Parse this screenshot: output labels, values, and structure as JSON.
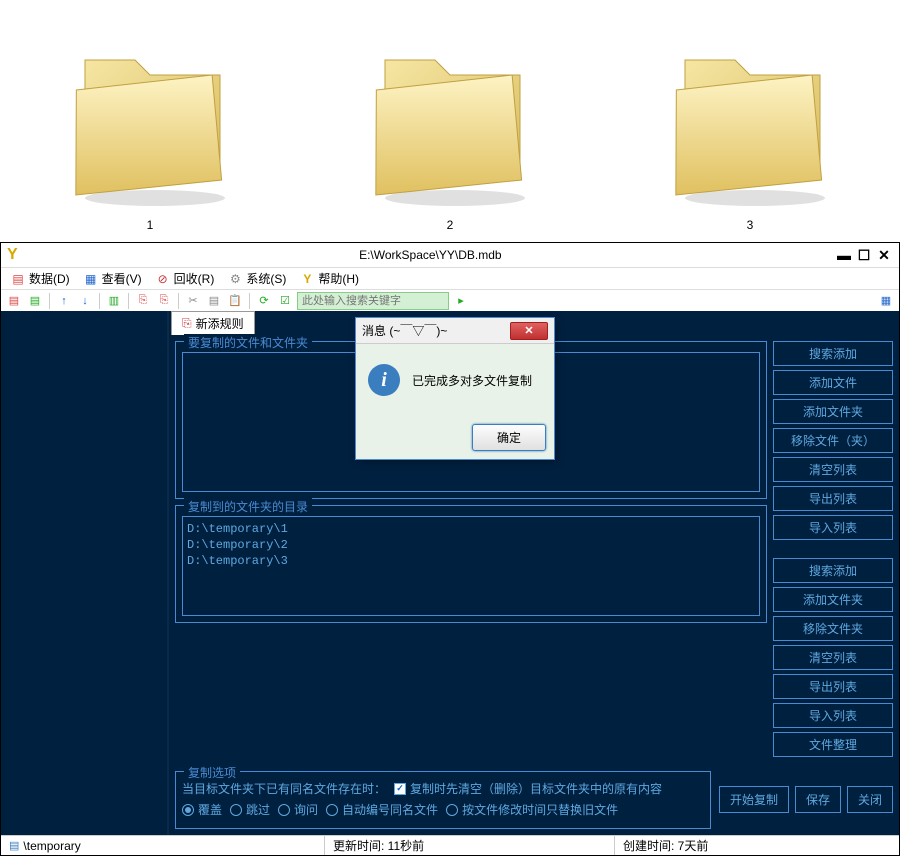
{
  "folders": [
    "1",
    "2",
    "3"
  ],
  "app": {
    "title": "E:\\WorkSpace\\YY\\DB.mdb",
    "menu": [
      {
        "icon": "📄",
        "label": "数据(D)",
        "color": "#c44"
      },
      {
        "icon": "▦",
        "label": "查看(V)",
        "color": "#26c"
      },
      {
        "icon": "⊘",
        "label": "回收(R)",
        "color": "#c33"
      },
      {
        "icon": "⚙",
        "label": "系统(S)",
        "color": "#888"
      },
      {
        "icon": "Y",
        "label": "帮助(H)",
        "color": "#d9a800"
      }
    ],
    "search_placeholder": "此处输入搜索关键字",
    "tab": {
      "label": "新添规则"
    },
    "group1_title": "要复制的文件和文件夹",
    "group2_title": "复制到的文件夹的目录",
    "dest_paths": [
      "D:\\temporary\\1",
      "D:\\temporary\\2",
      "D:\\temporary\\3"
    ],
    "side_buttons_1": [
      "搜索添加",
      "添加文件",
      "添加文件夹",
      "移除文件（夹）",
      "清空列表",
      "导出列表",
      "导入列表"
    ],
    "side_buttons_2": [
      "搜索添加",
      "添加文件夹",
      "移除文件夹",
      "清空列表",
      "导出列表",
      "导入列表",
      "文件整理"
    ],
    "options_title": "复制选项",
    "options_prompt": "当目标文件夹下已有同名文件存在时：",
    "checkbox_label": "复制时先清空（删除）目标文件夹中的原有内容",
    "radio_options": [
      "覆盖",
      "跳过",
      "询问",
      "自动编号同名文件",
      "按文件修改时间只替换旧文件"
    ],
    "radio_selected": 0,
    "action_buttons": [
      "开始复制",
      "保存",
      "关闭"
    ],
    "status": {
      "path": "\\temporary",
      "update": "更新时间: 11秒前",
      "create": "创建时间: 7天前"
    }
  },
  "dialog": {
    "title": "消息 (~￣▽￣)~",
    "message": "已完成多对多文件复制",
    "ok": "确定"
  }
}
